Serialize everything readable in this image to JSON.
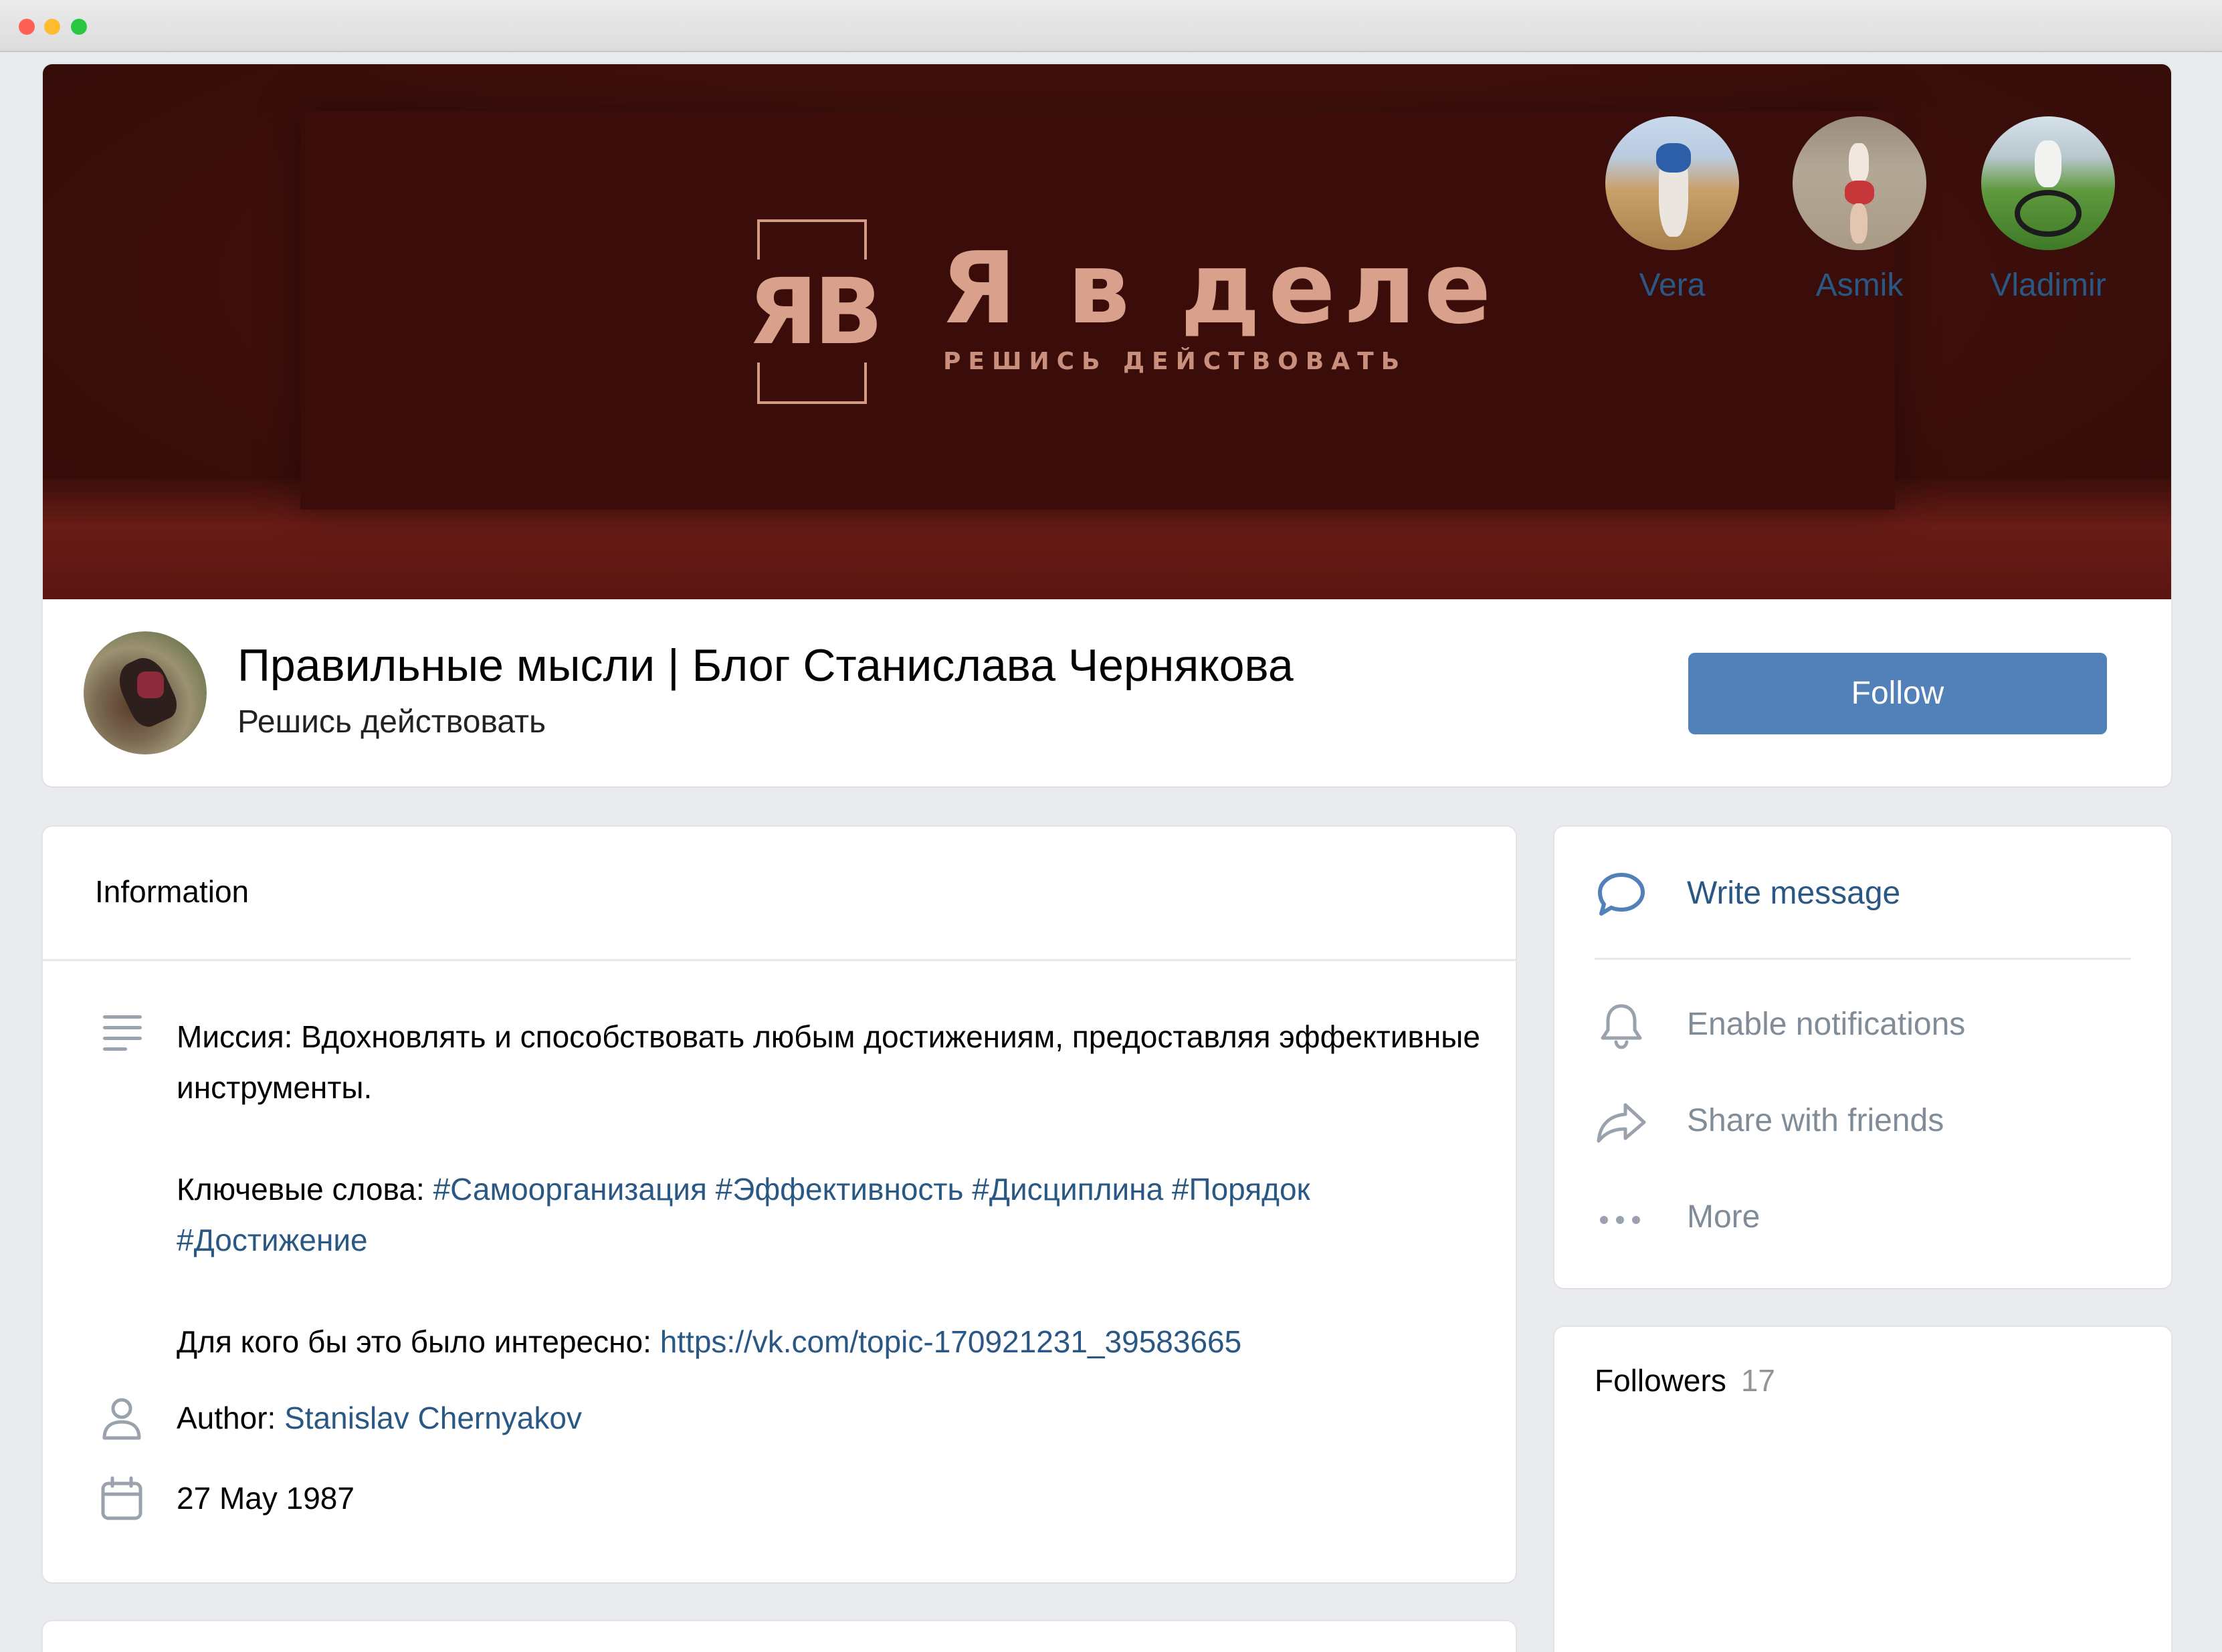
{
  "cover": {
    "logo_mark": "ЯВ",
    "logo_title": "Я в деле",
    "logo_tagline": "РЕШИСЬ ДЕЙСТВОВАТЬ"
  },
  "group": {
    "title": "Правильные мысли | Блог Станислава Чернякова",
    "status": "Решись действовать",
    "follow_label": "Follow"
  },
  "info": {
    "heading": "Information",
    "mission": "Миссия: Вдохновлять и способствовать любым достижениям, предоставляя эффективные инструменты.",
    "keywords_label": "Ключевые слова: ",
    "keywords": "#Самоорганизация #Эффективность #Дисциплина #Порядок #Достижение",
    "audience_label": "Для кого бы это было интересно: ",
    "audience_link": "https://vk.com/topic-170921231_39583665",
    "author_label": "Author: ",
    "author_name": "Stanislav Chernyakov",
    "date": "27 May 1987"
  },
  "actions": {
    "write_message": "Write message",
    "enable_notifications": "Enable notifications",
    "share_with_friends": "Share with friends",
    "more": "More"
  },
  "followers": {
    "heading": "Followers",
    "count": "17",
    "items": [
      {
        "name": "Vera"
      },
      {
        "name": "Asmik"
      },
      {
        "name": "Vladimir"
      }
    ]
  },
  "colors": {
    "accent": "#5181b8",
    "link": "#2a5885",
    "muted": "#818c99",
    "cover": "#3a0d0a"
  },
  "icons": [
    "description-icon",
    "user-icon",
    "calendar-icon",
    "message-icon",
    "bell-icon",
    "share-icon",
    "more-icon"
  ]
}
